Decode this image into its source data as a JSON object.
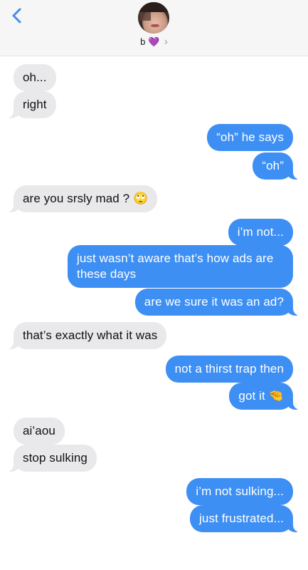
{
  "header": {
    "contact_name": "b",
    "contact_heart": "💜",
    "chevron": "›",
    "accent_color": "#3E8FF3"
  },
  "messages": [
    {
      "side": "in",
      "text": "oh..."
    },
    {
      "side": "in",
      "text": "right"
    },
    {
      "side": "out",
      "text": "“oh” he says"
    },
    {
      "side": "out",
      "text": "“oh”"
    },
    {
      "side": "in",
      "text": "are you srsly mad ?",
      "emoji": "🙄"
    },
    {
      "side": "out",
      "text": "i’m not..."
    },
    {
      "side": "out",
      "line1": "just wasn’t aware that’s how ads are",
      "line2": "these days"
    },
    {
      "side": "out",
      "text": "are we sure it was an ad?"
    },
    {
      "side": "in",
      "text": "that’s exactly what it was"
    },
    {
      "side": "out",
      "text": "not a thirst trap then"
    },
    {
      "side": "out",
      "text": "got it",
      "emoji": "🤏"
    },
    {
      "side": "in",
      "text": "ai’aou"
    },
    {
      "side": "in",
      "text": "stop sulking"
    },
    {
      "side": "out",
      "text": "i’m not sulking..."
    },
    {
      "side": "out",
      "text": "just frustrated..."
    }
  ]
}
